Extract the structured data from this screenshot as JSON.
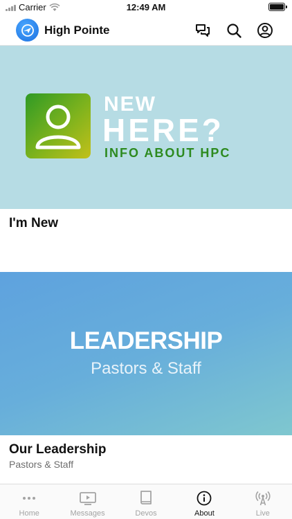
{
  "status_bar": {
    "carrier": "Carrier",
    "time": "12:49 AM"
  },
  "header": {
    "title": "High Pointe",
    "icons": [
      "chat-icon",
      "search-icon",
      "profile-icon"
    ]
  },
  "cards": [
    {
      "hero": {
        "line1": "NEW",
        "line2": "HERE?",
        "line3": "INFO ABOUT HPC",
        "background": "#b6dce4",
        "accent": "#2d8a1f"
      },
      "title": "I'm New"
    },
    {
      "hero": {
        "line1": "LEADERSHIP",
        "line2": "Pastors & Staff"
      },
      "title": "Our Leadership",
      "subtitle": "Pastors & Staff"
    }
  ],
  "tabs": [
    {
      "label": "Home",
      "icon": "more-dots-icon",
      "active": false
    },
    {
      "label": "Messages",
      "icon": "video-icon",
      "active": false
    },
    {
      "label": "Devos",
      "icon": "book-icon",
      "active": false
    },
    {
      "label": "About",
      "icon": "info-icon",
      "active": true
    },
    {
      "label": "Live",
      "icon": "broadcast-icon",
      "active": false
    }
  ],
  "colors": {
    "logo": "#1b6fe0",
    "active_tab": "#111111",
    "inactive_tab": "#a3a3a3"
  }
}
